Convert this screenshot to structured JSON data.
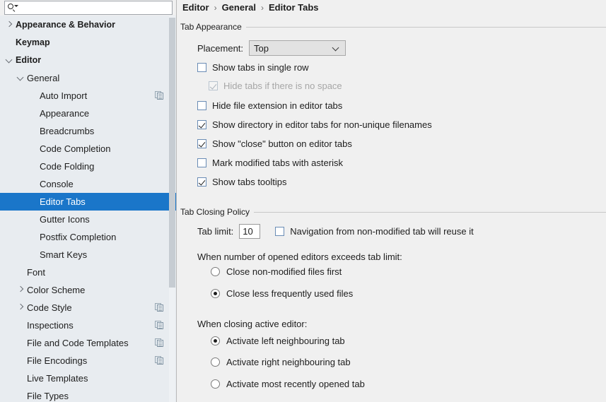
{
  "search": {
    "placeholder": "",
    "value": "",
    "icon": "search-icon"
  },
  "sidebar": {
    "items": [
      {
        "label": "Appearance & Behavior",
        "indent": 0,
        "twisty": "right",
        "bold": true,
        "selected": false,
        "copy": false
      },
      {
        "label": "Keymap",
        "indent": 0,
        "twisty": "none",
        "bold": true,
        "selected": false,
        "copy": false
      },
      {
        "label": "Editor",
        "indent": 0,
        "twisty": "down",
        "bold": true,
        "selected": false,
        "copy": false
      },
      {
        "label": "General",
        "indent": 1,
        "twisty": "down",
        "bold": false,
        "selected": false,
        "copy": false
      },
      {
        "label": "Auto Import",
        "indent": 2,
        "twisty": "none",
        "bold": false,
        "selected": false,
        "copy": true
      },
      {
        "label": "Appearance",
        "indent": 2,
        "twisty": "none",
        "bold": false,
        "selected": false,
        "copy": false
      },
      {
        "label": "Breadcrumbs",
        "indent": 2,
        "twisty": "none",
        "bold": false,
        "selected": false,
        "copy": false
      },
      {
        "label": "Code Completion",
        "indent": 2,
        "twisty": "none",
        "bold": false,
        "selected": false,
        "copy": false
      },
      {
        "label": "Code Folding",
        "indent": 2,
        "twisty": "none",
        "bold": false,
        "selected": false,
        "copy": false
      },
      {
        "label": "Console",
        "indent": 2,
        "twisty": "none",
        "bold": false,
        "selected": false,
        "copy": false
      },
      {
        "label": "Editor Tabs",
        "indent": 2,
        "twisty": "none",
        "bold": false,
        "selected": true,
        "copy": false
      },
      {
        "label": "Gutter Icons",
        "indent": 2,
        "twisty": "none",
        "bold": false,
        "selected": false,
        "copy": false
      },
      {
        "label": "Postfix Completion",
        "indent": 2,
        "twisty": "none",
        "bold": false,
        "selected": false,
        "copy": false
      },
      {
        "label": "Smart Keys",
        "indent": 2,
        "twisty": "none",
        "bold": false,
        "selected": false,
        "copy": false
      },
      {
        "label": "Font",
        "indent": 1,
        "twisty": "none",
        "bold": false,
        "selected": false,
        "copy": false
      },
      {
        "label": "Color Scheme",
        "indent": 1,
        "twisty": "right",
        "bold": false,
        "selected": false,
        "copy": false
      },
      {
        "label": "Code Style",
        "indent": 1,
        "twisty": "right",
        "bold": false,
        "selected": false,
        "copy": true
      },
      {
        "label": "Inspections",
        "indent": 1,
        "twisty": "none",
        "bold": false,
        "selected": false,
        "copy": true
      },
      {
        "label": "File and Code Templates",
        "indent": 1,
        "twisty": "none",
        "bold": false,
        "selected": false,
        "copy": true
      },
      {
        "label": "File Encodings",
        "indent": 1,
        "twisty": "none",
        "bold": false,
        "selected": false,
        "copy": true
      },
      {
        "label": "Live Templates",
        "indent": 1,
        "twisty": "none",
        "bold": false,
        "selected": false,
        "copy": false
      },
      {
        "label": "File Types",
        "indent": 1,
        "twisty": "none",
        "bold": false,
        "selected": false,
        "copy": false
      }
    ],
    "scrollbar": {
      "name": "sidebar-scrollbar"
    }
  },
  "breadcrumb": {
    "crumb1": "Editor",
    "crumb2": "General",
    "crumb3": "Editor Tabs",
    "separator": "›"
  },
  "tab_appearance": {
    "title": "Tab Appearance",
    "placement_label": "Placement:",
    "placement_value": "Top",
    "options": [
      {
        "label": "Show tabs in single row",
        "checked": false,
        "disabled": false
      },
      {
        "label": "Hide tabs if there is no space",
        "checked": true,
        "disabled": true
      },
      {
        "label": "Hide file extension in editor tabs",
        "checked": false,
        "disabled": false
      },
      {
        "label": "Show directory in editor tabs for non-unique filenames",
        "checked": true,
        "disabled": false
      },
      {
        "label": "Show \"close\" button on editor tabs",
        "checked": true,
        "disabled": false
      },
      {
        "label": "Mark modified tabs with asterisk",
        "checked": false,
        "disabled": false
      },
      {
        "label": "Show tabs tooltips",
        "checked": true,
        "disabled": false
      }
    ]
  },
  "tab_closing_policy": {
    "title": "Tab Closing Policy",
    "tab_limit_label": "Tab limit:",
    "tab_limit_value": "10",
    "navigation_reuse_label": "Navigation from non-modified tab will reuse it",
    "navigation_reuse_checked": false,
    "exceeds_group_label": "When number of opened editors exceeds tab limit:",
    "exceeds_options": [
      {
        "label": "Close non-modified files first",
        "checked": false
      },
      {
        "label": "Close less frequently used files",
        "checked": true
      }
    ],
    "closing_group_label": "When closing active editor:",
    "closing_options": [
      {
        "label": "Activate left neighbouring tab",
        "checked": true
      },
      {
        "label": "Activate right neighbouring tab",
        "checked": false
      },
      {
        "label": "Activate most recently opened tab",
        "checked": false
      }
    ]
  },
  "colors": {
    "selection": "#1a76c9",
    "sidebar_bg": "#e8ecf0",
    "content_bg": "#f0f0f0",
    "text": "#1d1d1d",
    "disabled_text": "#a6a6a6"
  }
}
